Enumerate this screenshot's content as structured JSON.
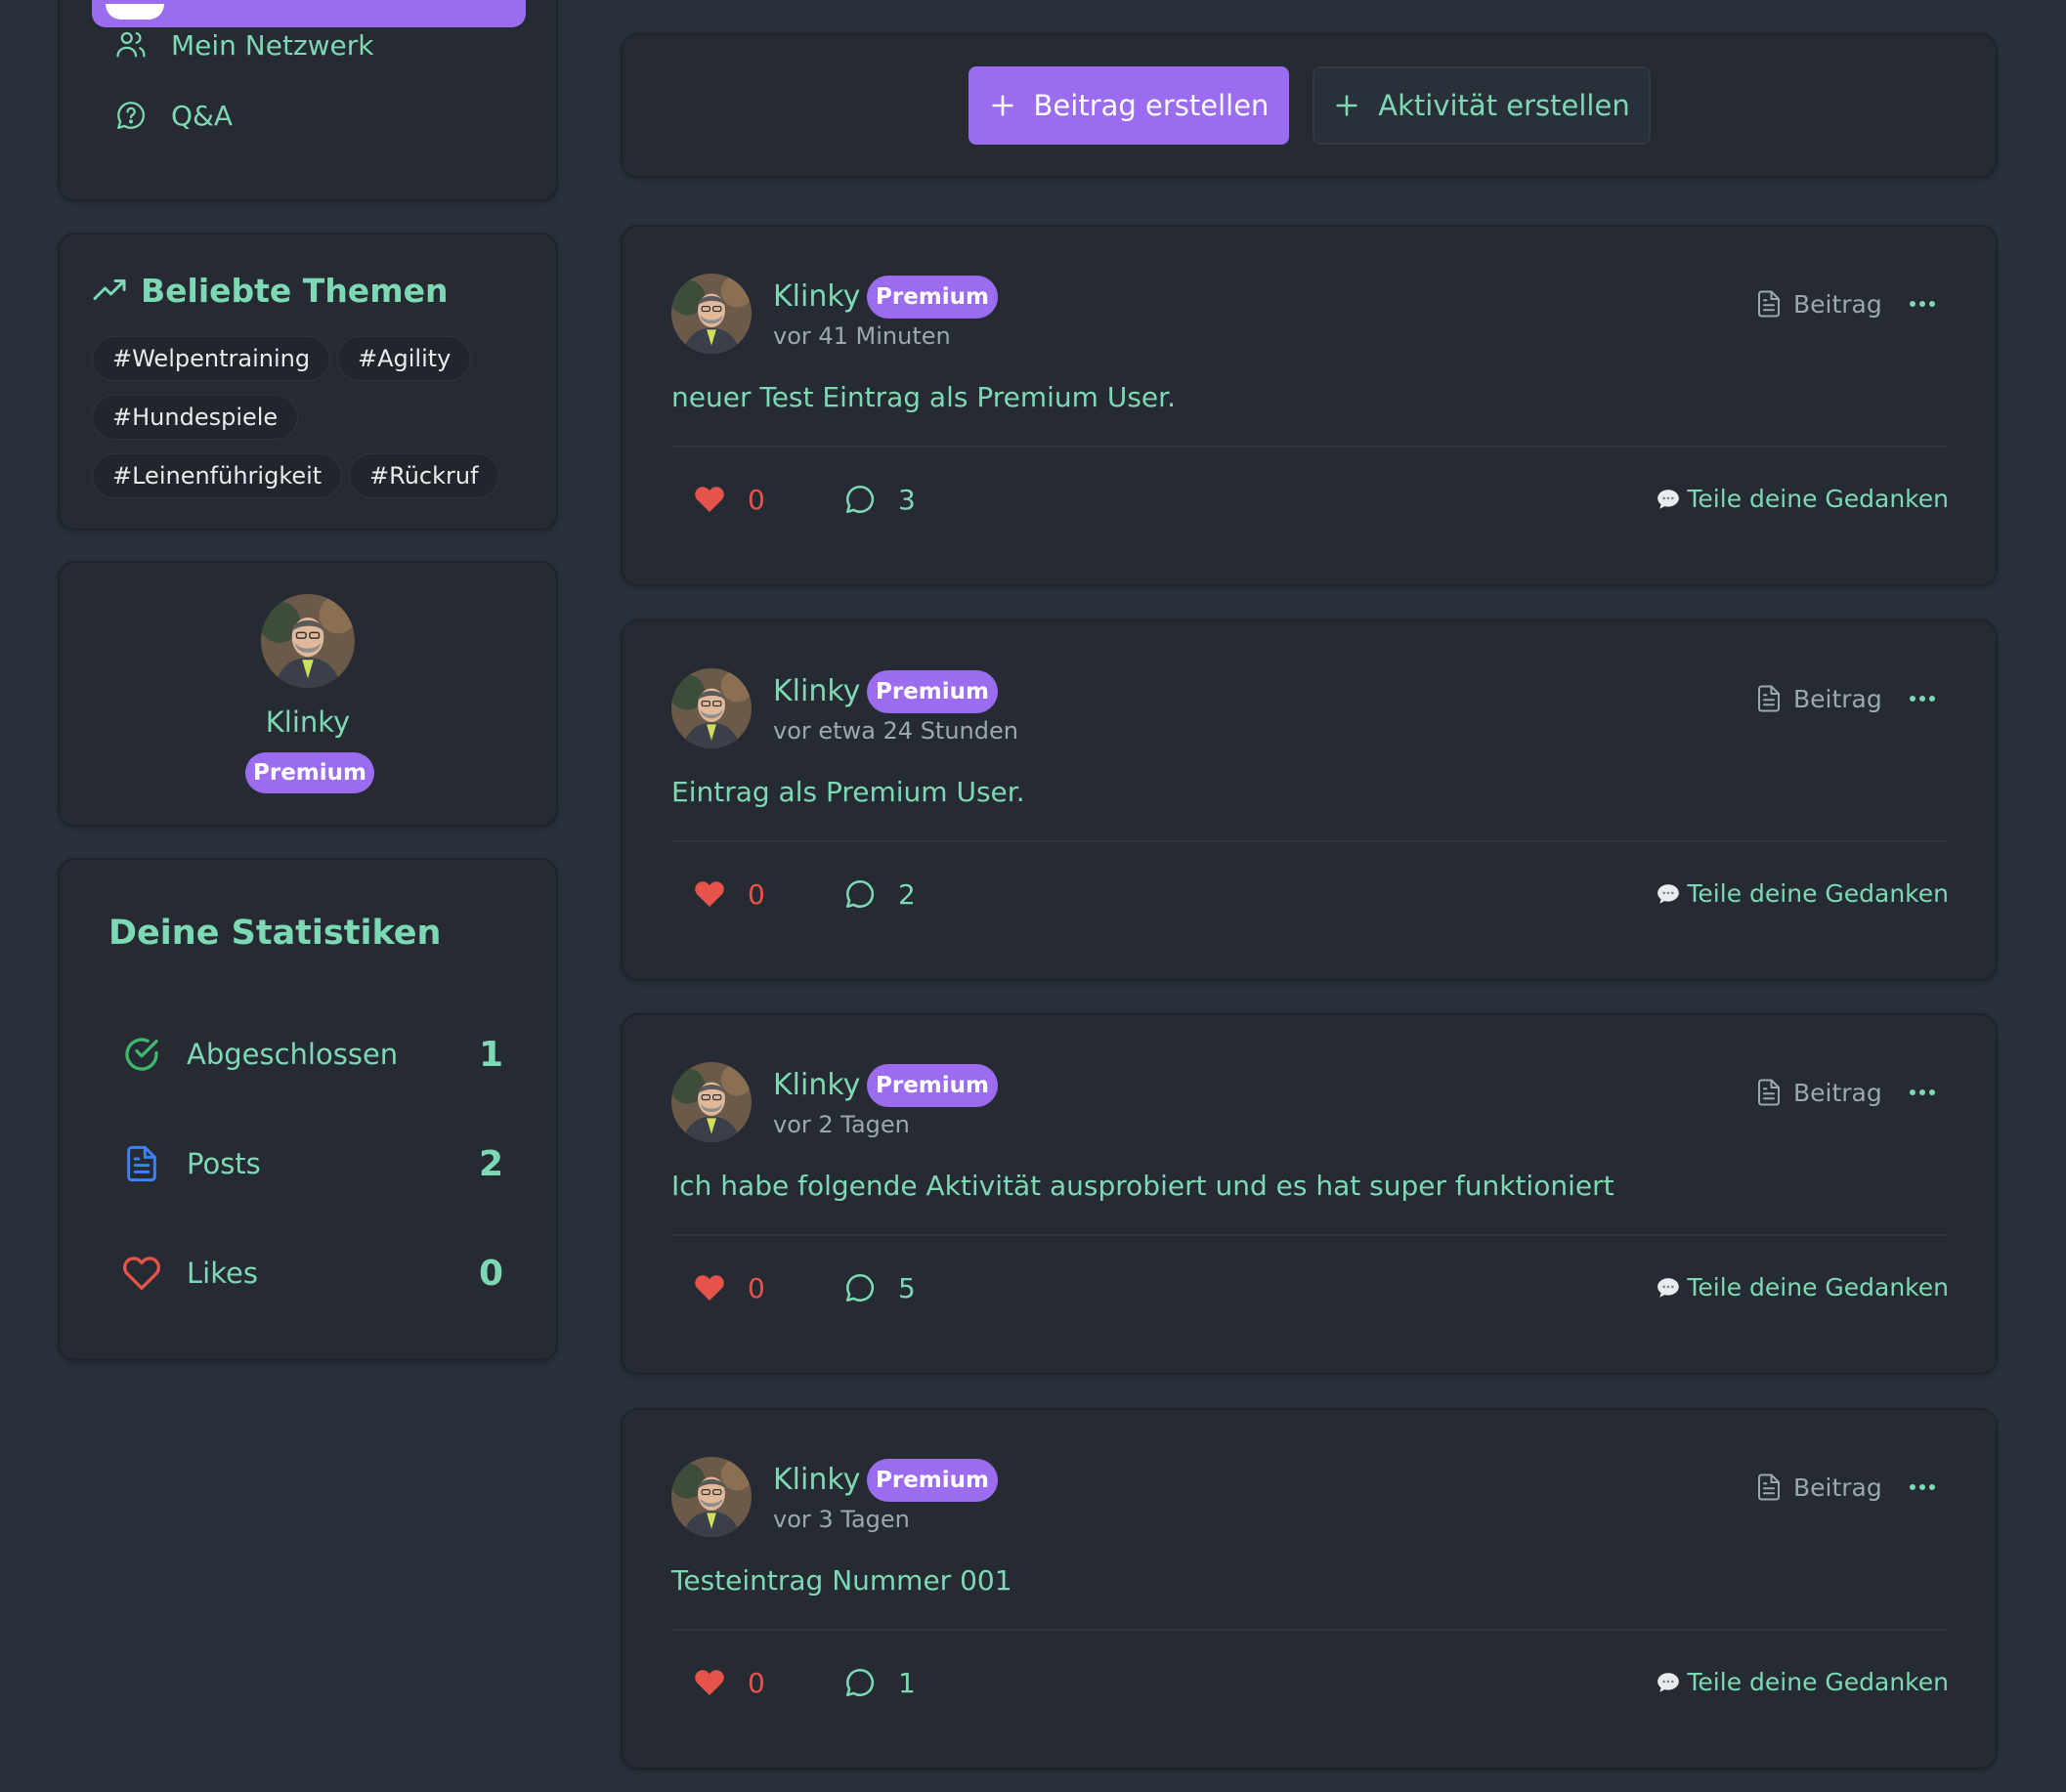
{
  "colors": {
    "background": "#29313d",
    "card": "#262b33",
    "accent": "#9b6cf0",
    "text_primary": "#7dd9b3",
    "text_muted": "#9aa8b0",
    "like": "#e5534b"
  },
  "sidebar": {
    "nav": {
      "items": [
        {
          "label": "Mein Netzwerk",
          "icon": "users-icon"
        },
        {
          "label": "Q&A",
          "icon": "question-bubble-icon"
        }
      ]
    },
    "topics": {
      "title": "Beliebte Themen",
      "icon": "trending-up-icon",
      "tags": [
        "#Welpentraining",
        "#Agility",
        "#Hundespiele",
        "#Leinenführigkeit",
        "#Rückruf"
      ]
    },
    "profile": {
      "name": "Klinky",
      "badge": "Premium"
    },
    "stats": {
      "title": "Deine Statistiken",
      "items": [
        {
          "label": "Abgeschlossen",
          "value": "1",
          "icon": "check-circle-icon",
          "color": "#3fb86f"
        },
        {
          "label": "Posts",
          "value": "2",
          "icon": "document-icon",
          "color": "#3b82f6"
        },
        {
          "label": "Likes",
          "value": "0",
          "icon": "heart-outline-icon",
          "color": "#e5534b"
        }
      ]
    }
  },
  "create_bar": {
    "post_button": "Beitrag erstellen",
    "activity_button": "Aktivität erstellen"
  },
  "posts": [
    {
      "author": "Klinky",
      "badge": "Premium",
      "time": "vor 41 Minuten",
      "type": "Beitrag",
      "text": "neuer Test Eintrag als Premium User.",
      "likes": "0",
      "comments": "3",
      "share": "Teile deine Gedanken"
    },
    {
      "author": "Klinky",
      "badge": "Premium",
      "time": "vor etwa 24 Stunden",
      "type": "Beitrag",
      "text": "Eintrag als Premium User.",
      "likes": "0",
      "comments": "2",
      "share": "Teile deine Gedanken"
    },
    {
      "author": "Klinky",
      "badge": "Premium",
      "time": "vor 2 Tagen",
      "type": "Beitrag",
      "text": "Ich habe folgende Aktivität ausprobiert und es hat super funktioniert",
      "likes": "0",
      "comments": "5",
      "share": "Teile deine Gedanken"
    },
    {
      "author": "Klinky",
      "badge": "Premium",
      "time": "vor 3 Tagen",
      "type": "Beitrag",
      "text": "Testeintrag Nummer 001",
      "likes": "0",
      "comments": "1",
      "share": "Teile deine Gedanken"
    }
  ]
}
